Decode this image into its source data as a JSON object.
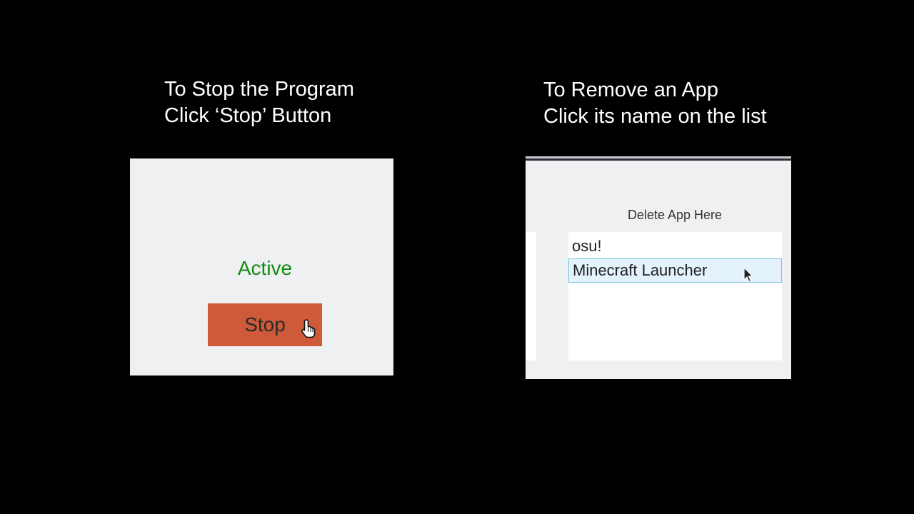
{
  "captions": {
    "left": {
      "line1": "To Stop the Program",
      "line2": "Click ‘Stop’ Button"
    },
    "right": {
      "line1": "To Remove an App",
      "line2": "Click its name on the list"
    }
  },
  "left_panel": {
    "status": "Active",
    "status_color": "#138a13",
    "stop_button": "Stop",
    "stop_button_color": "#cf5a3a",
    "cursor_icon": "hand-pointer-icon"
  },
  "right_panel": {
    "header": "Delete App Here",
    "apps": [
      {
        "name": "osu!",
        "selected": false
      },
      {
        "name": "Minecraft Launcher",
        "selected": true
      }
    ],
    "selection_color": "#e3f2fb",
    "cursor_icon": "arrow-pointer-icon"
  }
}
